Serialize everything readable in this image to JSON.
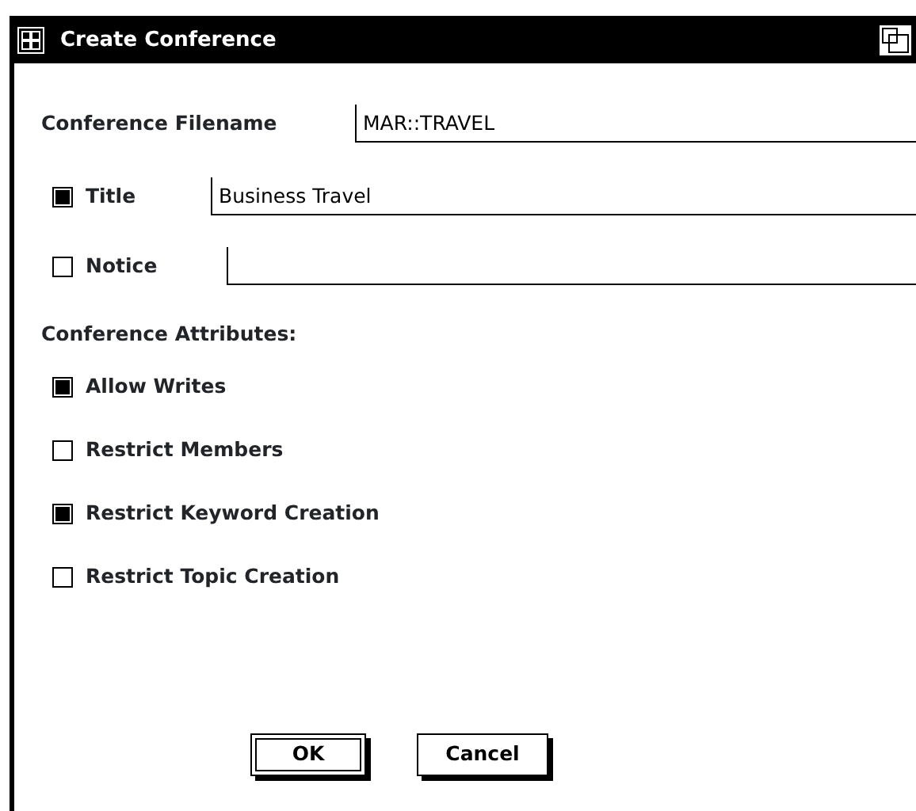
{
  "window": {
    "title": "Create Conference"
  },
  "filename": {
    "label": "Conference Filename",
    "value": "MAR::TRAVEL"
  },
  "text_fields": [
    {
      "label": "Title",
      "checked": true,
      "value": "Business Travel"
    },
    {
      "label": "Notice",
      "checked": false
    }
  ],
  "attributes_heading": "Conference Attributes:",
  "attributes": [
    {
      "label": "Allow Writes",
      "checked": true
    },
    {
      "label": "Restrict Members",
      "checked": false
    },
    {
      "label": "Restrict Keyword Creation",
      "checked": true
    },
    {
      "label": "Restrict Topic Creation",
      "checked": false
    }
  ],
  "buttons": [
    {
      "label": "OK",
      "default": true
    },
    {
      "label": "Cancel",
      "default": false
    }
  ]
}
